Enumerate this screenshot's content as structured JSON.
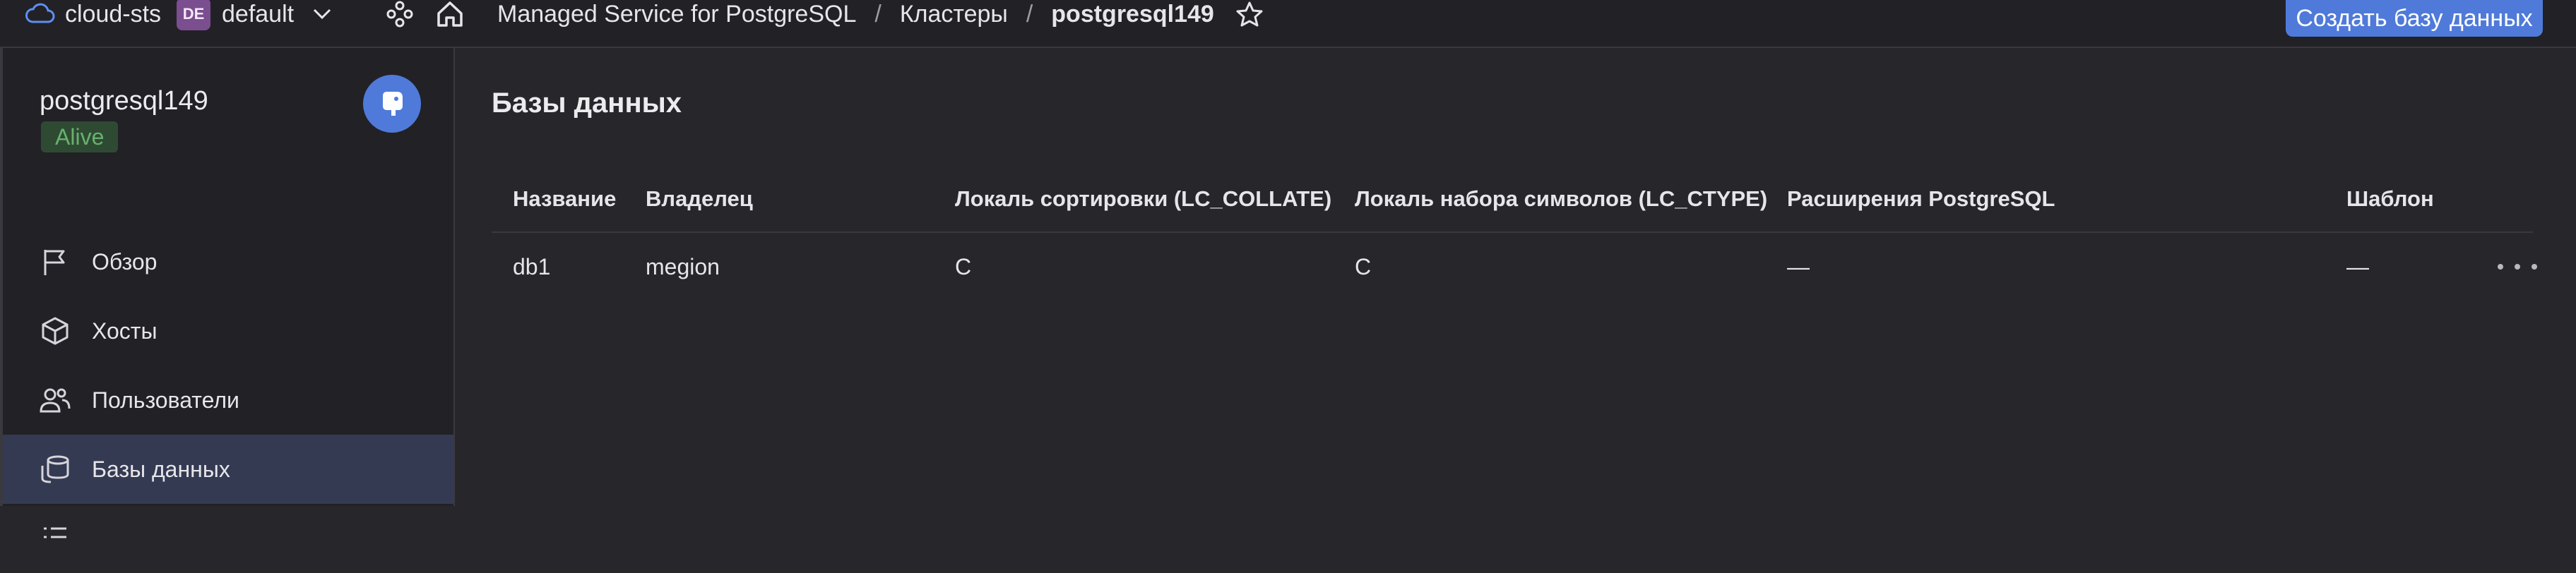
{
  "topbar": {
    "cloud_name": "cloud-sts",
    "folder_badge": "DE",
    "folder_name": "default",
    "breadcrumbs": [
      "Managed Service for PostgreSQL",
      "Кластеры",
      "postgresql149"
    ],
    "separator": "/",
    "create_button": "Создать базу данных"
  },
  "sidebar": {
    "cluster_name": "postgresql149",
    "status": "Alive",
    "items": [
      {
        "label": "Обзор",
        "icon": "flag-icon"
      },
      {
        "label": "Хосты",
        "icon": "cube-icon"
      },
      {
        "label": "Пользователи",
        "icon": "users-icon"
      },
      {
        "label": "Базы данных",
        "icon": "databases-icon",
        "active": true
      }
    ]
  },
  "main": {
    "title": "Базы данных",
    "columns": [
      "Название",
      "Владелец",
      "Локаль сортировки (LC_COLLATE)",
      "Локаль набора символов (LC_CTYPE)",
      "Расширения PostgreSQL",
      "Шаблон"
    ],
    "rows": [
      {
        "name": "db1",
        "owner": "megion",
        "lc_collate": "C",
        "lc_ctype": "C",
        "extensions": "—",
        "template": "—"
      }
    ]
  },
  "colors": {
    "accent": "#4f7ad9",
    "status_alive": "#67b16f",
    "background": "#27262b",
    "active_nav": "#343a52"
  }
}
